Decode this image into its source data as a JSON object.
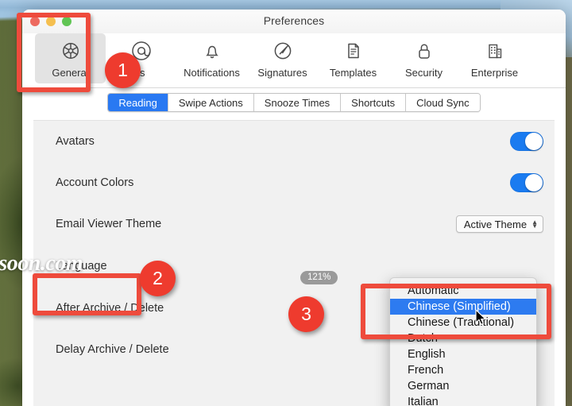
{
  "window": {
    "title": "Preferences",
    "traffic_lights": [
      "close",
      "minimize",
      "zoom"
    ]
  },
  "toolbar": {
    "items": [
      {
        "label": "General",
        "icon": "gear-icon",
        "active": true
      },
      {
        "label": "ts",
        "icon": "at-sign-icon",
        "active": false
      },
      {
        "label": "Notifications",
        "icon": "bell-icon",
        "active": false
      },
      {
        "label": "Signatures",
        "icon": "signature-pen-icon",
        "active": false
      },
      {
        "label": "Templates",
        "icon": "document-icon",
        "active": false
      },
      {
        "label": "Security",
        "icon": "lock-icon",
        "active": false
      },
      {
        "label": "Enterprise",
        "icon": "building-icon",
        "active": false
      }
    ]
  },
  "tabs": [
    {
      "label": "Reading",
      "selected": true
    },
    {
      "label": "Swipe Actions",
      "selected": false
    },
    {
      "label": "Snooze Times",
      "selected": false
    },
    {
      "label": "Shortcuts",
      "selected": false
    },
    {
      "label": "Cloud Sync",
      "selected": false
    }
  ],
  "settings": {
    "rows": [
      {
        "label": "Avatars",
        "control": "toggle",
        "value": "on"
      },
      {
        "label": "Account Colors",
        "control": "toggle",
        "value": "on"
      },
      {
        "label": "Email Viewer Theme",
        "control": "popup",
        "value": "Active Theme"
      },
      {
        "label": "Language",
        "control": "popup",
        "value": ""
      },
      {
        "label": "After Archive / Delete",
        "control": "none",
        "value": ""
      },
      {
        "label": "Delay Archive / Delete",
        "control": "none",
        "value": ""
      }
    ]
  },
  "language_menu": {
    "items": [
      {
        "label": "Automatic",
        "highlighted": false
      },
      {
        "label": "Chinese (Simplified)",
        "highlighted": true
      },
      {
        "label": "Chinese (Traditional)",
        "highlighted": false
      },
      {
        "label": "Dutch",
        "highlighted": false
      },
      {
        "label": "English",
        "highlighted": false
      },
      {
        "label": "French",
        "highlighted": false
      },
      {
        "label": "German",
        "highlighted": false
      },
      {
        "label": "Italian",
        "highlighted": false
      }
    ]
  },
  "zoom_indicator": {
    "value": "121%"
  },
  "watermark": {
    "text": "rsoon.com"
  },
  "annotations": {
    "badges": [
      {
        "number": "1"
      },
      {
        "number": "2"
      },
      {
        "number": "3"
      }
    ],
    "accent_color": "#ee3b2e",
    "box_color": "#ee4b3c"
  }
}
